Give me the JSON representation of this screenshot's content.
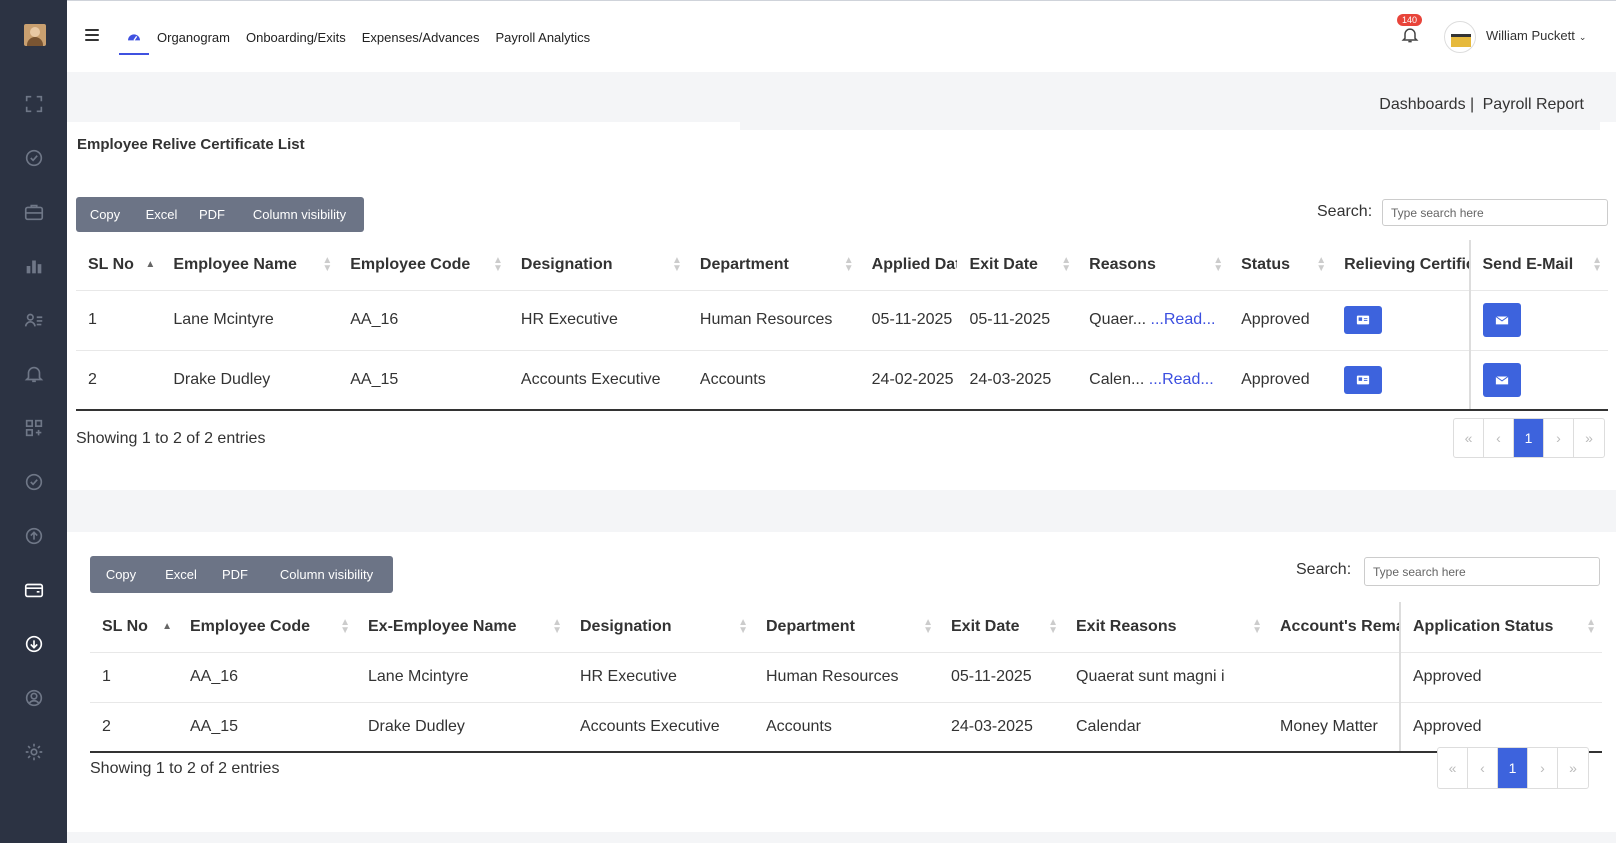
{
  "header": {
    "nav": [
      "Organogram",
      "Onboarding/Exits",
      "Expenses/Advances",
      "Payroll Analytics"
    ],
    "notification_count": "140",
    "user_name": "William Puckett"
  },
  "breadcrumb": {
    "first": "Dashboards |",
    "second": "Payroll Report"
  },
  "card1": {
    "title": "Employee Relive Certificate List",
    "buttons": [
      "Copy",
      "Excel",
      "PDF",
      "Column visibility"
    ],
    "search_label": "Search:",
    "search_placeholder": "Type search here",
    "columns": [
      "SL No",
      "Employee Name",
      "Employee Code",
      "Designation",
      "Department",
      "Applied Date",
      "Exit Date",
      "Reasons",
      "Status",
      "Relieving Certificate",
      "Send E-Mail"
    ],
    "rows": [
      {
        "sl": "1",
        "name": "Lane Mcintyre",
        "code": "AA_16",
        "designation": "HR Executive",
        "department": "Human Resources",
        "applied": "05-11-2025",
        "exit": "05-11-2025",
        "reason": "Quaer...",
        "read_more": "...Read...",
        "status": "Approved"
      },
      {
        "sl": "2",
        "name": "Drake Dudley",
        "code": "AA_15",
        "designation": "Accounts Executive",
        "department": "Accounts",
        "applied": "24-02-2025",
        "exit": "24-03-2025",
        "reason": "Calen...",
        "read_more": "...Read...",
        "status": "Approved"
      }
    ],
    "info": "Showing 1 to 2 of 2 entries",
    "pager": [
      "«",
      "‹",
      "1",
      "›",
      "»"
    ]
  },
  "card2": {
    "buttons": [
      "Copy",
      "Excel",
      "PDF",
      "Column visibility"
    ],
    "search_label": "Search:",
    "search_placeholder": "Type search here",
    "columns": [
      "SL No",
      "Employee Code",
      "Ex-Employee Name",
      "Designation",
      "Department",
      "Exit Date",
      "Exit Reasons",
      "Account's Remarks",
      "Application Status"
    ],
    "rows": [
      {
        "sl": "1",
        "code": "AA_16",
        "name": "Lane Mcintyre",
        "designation": "HR Executive",
        "department": "Human Resources",
        "exit": "05-11-2025",
        "reason": "Quaerat sunt magni i",
        "remarks": "",
        "status": "Approved"
      },
      {
        "sl": "2",
        "code": "AA_15",
        "name": "Drake Dudley",
        "designation": "Accounts Executive",
        "department": "Accounts",
        "exit": "24-03-2025",
        "reason": "Calendar",
        "remarks": "Money Matter",
        "status": "Approved"
      }
    ],
    "info": "Showing 1 to 2 of 2 entries",
    "pager": [
      "«",
      "‹",
      "1",
      "›",
      "»"
    ]
  }
}
